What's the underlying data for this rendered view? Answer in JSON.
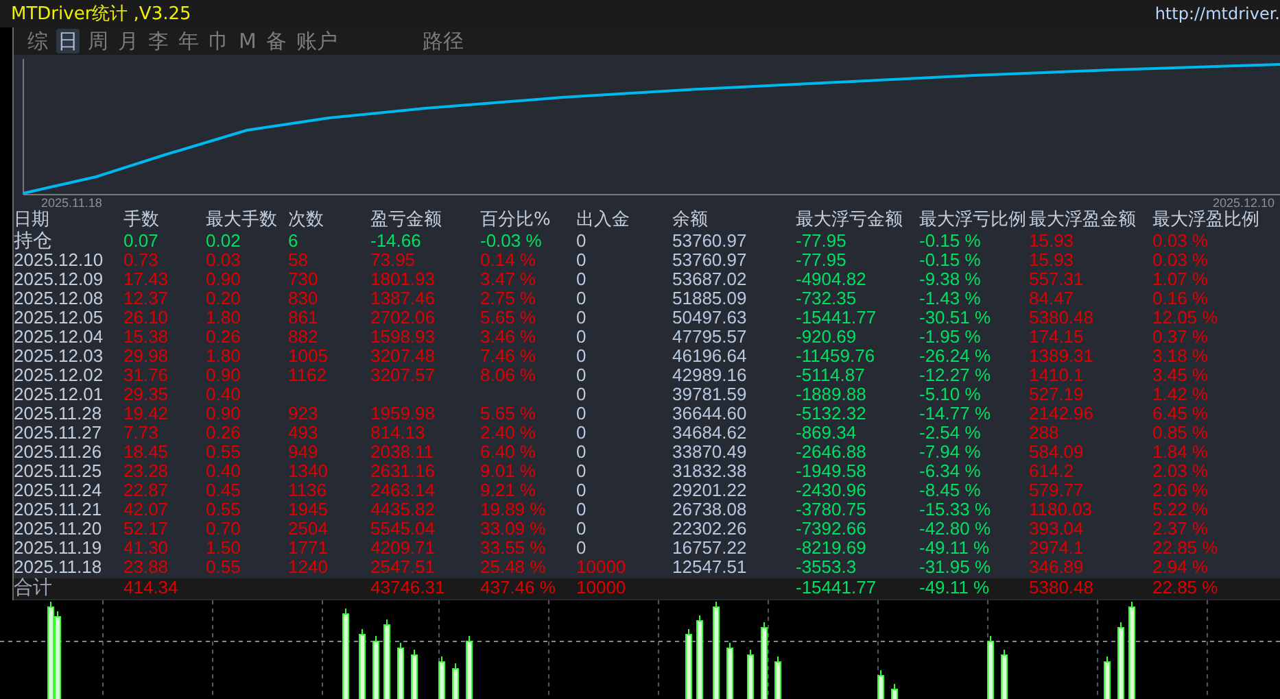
{
  "window": {
    "title": "MTDriver统计 ,V3.25",
    "url": "http://mtdriver."
  },
  "tabs": [
    {
      "label": "综",
      "selected": false
    },
    {
      "label": "日",
      "selected": true
    },
    {
      "label": "周",
      "selected": false
    },
    {
      "label": "月",
      "selected": false
    },
    {
      "label": "李",
      "selected": false
    },
    {
      "label": "年",
      "selected": false
    },
    {
      "label": "巾",
      "selected": false
    },
    {
      "label": "M",
      "selected": false
    },
    {
      "label": "备",
      "selected": false
    },
    {
      "label": "账户",
      "selected": false
    }
  ],
  "path_button": "路径",
  "equity_chart": {
    "start_label": "2025.11.18",
    "end_label": "2025.12.10"
  },
  "table": {
    "columns": [
      "日期",
      "手数",
      "最大手数",
      "次数",
      "盈亏金额",
      "百分比%",
      "出入金",
      "余额",
      "最大浮亏金额",
      "最大浮亏比例",
      "最大浮盈金额",
      "最大浮盈比例"
    ],
    "rows": [
      {
        "kind": "open",
        "cells": [
          "持仓",
          "0.07",
          "0.02",
          "6",
          "-14.66",
          "-0.03 %",
          "0",
          "53760.97",
          "-77.95",
          "-0.15 %",
          "15.93",
          "0.03 %"
        ]
      },
      {
        "kind": "day",
        "cells": [
          "2025.12.10",
          "0.73",
          "0.03",
          "58",
          "73.95",
          "0.14 %",
          "0",
          "53760.97",
          "-77.95",
          "-0.15 %",
          "15.93",
          "0.03 %"
        ]
      },
      {
        "kind": "day",
        "cells": [
          "2025.12.09",
          "17.43",
          "0.90",
          "730",
          "1801.93",
          "3.47 %",
          "0",
          "53687.02",
          "-4904.82",
          "-9.38 %",
          "557.31",
          "1.07 %"
        ]
      },
      {
        "kind": "day",
        "cells": [
          "2025.12.08",
          "12.37",
          "0.20",
          "830",
          "1387.46",
          "2.75 %",
          "0",
          "51885.09",
          "-732.35",
          "-1.43 %",
          "84.47",
          "0.16 %"
        ]
      },
      {
        "kind": "day",
        "cells": [
          "2025.12.05",
          "26.10",
          "1.80",
          "861",
          "2702.06",
          "5.65 %",
          "0",
          "50497.63",
          "-15441.77",
          "-30.51 %",
          "5380.48",
          "12.05 %"
        ]
      },
      {
        "kind": "day",
        "cells": [
          "2025.12.04",
          "15.38",
          "0.26",
          "882",
          "1598.93",
          "3.46 %",
          "0",
          "47795.57",
          "-920.69",
          "-1.95 %",
          "174.15",
          "0.37 %"
        ]
      },
      {
        "kind": "day",
        "cells": [
          "2025.12.03",
          "29.98",
          "1.80",
          "1005",
          "3207.48",
          "7.46 %",
          "0",
          "46196.64",
          "-11459.76",
          "-26.24 %",
          "1389.31",
          "3.18 %"
        ]
      },
      {
        "kind": "day",
        "cells": [
          "2025.12.02",
          "31.76",
          "0.90",
          "1162",
          "3207.57",
          "8.06 %",
          "0",
          "42989.16",
          "-5114.87",
          "-12.27 %",
          "1410.1",
          "3.45 %"
        ]
      },
      {
        "kind": "day",
        "cells": [
          "2025.12.01",
          "29.35",
          "0.40",
          null,
          null,
          null,
          "0",
          "39781.59",
          "-1889.88",
          "-5.10 %",
          "527.19",
          "1.42 %"
        ]
      },
      {
        "kind": "day",
        "cells": [
          "2025.11.28",
          "19.42",
          "0.90",
          "923",
          "1959.98",
          "5.65 %",
          "0",
          "36644.60",
          "-5132.32",
          "-14.77 %",
          "2142.96",
          "6.45 %"
        ]
      },
      {
        "kind": "day",
        "cells": [
          "2025.11.27",
          "7.73",
          "0.26",
          "493",
          "814.13",
          "2.40 %",
          "0",
          "34684.62",
          "-869.34",
          "-2.54 %",
          "288",
          "0.85 %"
        ]
      },
      {
        "kind": "day",
        "cells": [
          "2025.11.26",
          "18.45",
          "0.55",
          "949",
          "2038.11",
          "6.40 %",
          "0",
          "33870.49",
          "-2646.88",
          "-7.94 %",
          "584.09",
          "1.84 %"
        ]
      },
      {
        "kind": "day",
        "cells": [
          "2025.11.25",
          "23.28",
          "0.40",
          "1340",
          "2631.16",
          "9.01 %",
          "0",
          "31832.38",
          "-1949.58",
          "-6.34 %",
          "614.2",
          "2.03 %"
        ]
      },
      {
        "kind": "day",
        "cells": [
          "2025.11.24",
          "22.87",
          "0.45",
          "1136",
          "2463.14",
          "9.21 %",
          "0",
          "29201.22",
          "-2430.96",
          "-8.45 %",
          "579.77",
          "2.06 %"
        ]
      },
      {
        "kind": "day",
        "cells": [
          "2025.11.21",
          "42.07",
          "0.55",
          "1945",
          "4435.82",
          "19.89 %",
          "0",
          "26738.08",
          "-3780.75",
          "-15.33 %",
          "1180.03",
          "5.22 %"
        ]
      },
      {
        "kind": "day",
        "cells": [
          "2025.11.20",
          "52.17",
          "0.70",
          "2504",
          "5545.04",
          "33.09 %",
          "0",
          "22302.26",
          "-7392.66",
          "-42.80 %",
          "393.04",
          "2.37 %"
        ]
      },
      {
        "kind": "day",
        "cells": [
          "2025.11.19",
          "41.30",
          "1.50",
          "1771",
          "4209.71",
          "33.55 %",
          "0",
          "16757.22",
          "-8219.69",
          "-49.11 %",
          "2974.1",
          "22.85 %"
        ]
      },
      {
        "kind": "day",
        "cells": [
          "2025.11.18",
          "23.88",
          "0.55",
          "1240",
          "2547.51",
          "25.48 %",
          "10000",
          "12547.51",
          "-3553.3",
          "-31.95 %",
          "346.89",
          "2.94 %"
        ]
      }
    ],
    "total": {
      "cells": [
        "合计",
        "414.34",
        null,
        null,
        "43746.31",
        "437.46 %",
        "10000",
        null,
        "-15441.77",
        "-49.11 %",
        "5380.48",
        "22.85 %"
      ]
    }
  }
}
